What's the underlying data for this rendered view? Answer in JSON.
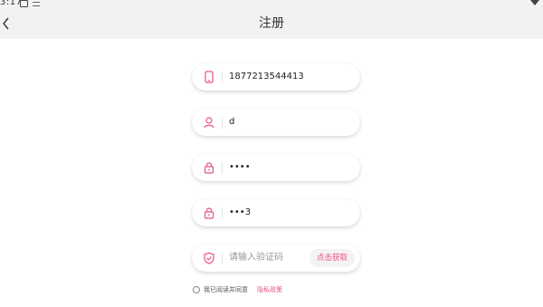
{
  "status_bar": {
    "time": "3:17"
  },
  "header": {
    "title": "注册"
  },
  "form": {
    "phone_value": "1877213544413",
    "username_value": "d",
    "password_value": "••••",
    "confirm_password_value": "•••3",
    "code_placeholder": "请输入验证码",
    "code_button_label": "点击获取"
  },
  "agreement": {
    "text": "我已阅读并同意",
    "link_label": "隐私政策"
  },
  "icons": {
    "back": "chevron-left-icon",
    "phone": "phone-icon",
    "user": "user-icon",
    "lock": "lock-icon",
    "shield": "shield-check-icon"
  },
  "colors": {
    "accent": "#e8508a",
    "nav_bg": "#f2f2f2"
  }
}
